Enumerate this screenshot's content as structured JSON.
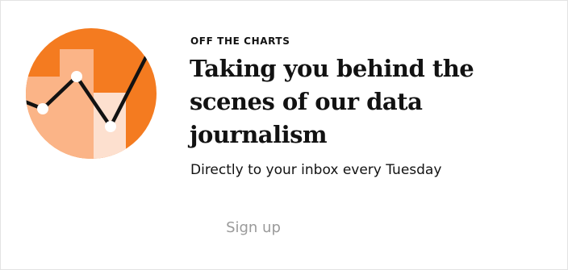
{
  "newsletter": {
    "kicker": "OFF THE CHARTS",
    "headline": "Taking you behind the scenes of our data journalism",
    "subtitle": "Directly to your inbox every Tuesday",
    "signup_label": "Sign up"
  },
  "illustration": {
    "icon": "chart-illustration-icon",
    "colors": {
      "background": "#f47b20",
      "bar_light": "#fbb487",
      "bar_lighter": "#fde0cf",
      "line": "#121212",
      "point_fill": "#ffffff"
    }
  }
}
